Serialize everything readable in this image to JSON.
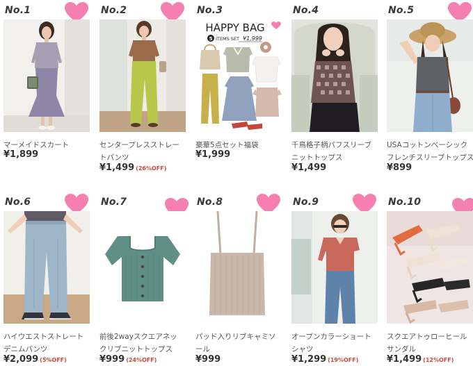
{
  "colors": {
    "heart": "#f57fb1",
    "rank_text": "#3a3a3a",
    "title_text": "#555555",
    "price_text": "#333333",
    "discount_text": "#d0473a"
  },
  "items": [
    {
      "rank": "No.1",
      "title_line1": "マーメイドスカート",
      "title_line2": "",
      "price": "¥1,899",
      "discount": "",
      "image": "model-lavender-mermaid-skirt"
    },
    {
      "rank": "No.2",
      "title_line1": "センタープレスストレー",
      "title_line2": "トパンツ",
      "price": "¥1,499",
      "discount": "(26%OFF)",
      "image": "model-lime-center-press-pants"
    },
    {
      "rank": "No.3",
      "title_line1": "豪華5点セット福袋",
      "title_line2": "",
      "price": "¥1,999",
      "discount": "",
      "image": "happy-bag-5-items-set",
      "banner": {
        "headline": "HAPPY BAG",
        "count": "5",
        "subline": "ITEMS SET",
        "price": "¥1,999"
      }
    },
    {
      "rank": "No.4",
      "title_line1": "千鳥格子柄パフスリーブ",
      "title_line2": "ニットトップス",
      "price": "¥1,499",
      "discount": "",
      "image": "model-houndstooth-puff-sleeve-knit"
    },
    {
      "rank": "No.5",
      "title_line1": "USAコットンベーシック",
      "title_line2": "フレンチスリーブトップス",
      "price": "¥899",
      "discount": "",
      "image": "model-gray-tee-straw-hat"
    },
    {
      "rank": "No.6",
      "title_line1": "ハイウエストストレート",
      "title_line2": "デニムパンツ",
      "price": "¥2,099",
      "discount": "(5%OFF)",
      "image": "model-light-straight-denim"
    },
    {
      "rank": "No.7",
      "title_line1": "前後2wayスクエアネッ",
      "title_line2": "クリブニットトップス",
      "price": "¥999",
      "discount": "(24%OFF)",
      "image": "green-square-neck-rib-knit"
    },
    {
      "rank": "No.8",
      "title_line1": "パッド入りリブキャミソ",
      "title_line2": "ール",
      "price": "¥999",
      "discount": "",
      "image": "beige-padded-rib-camisole"
    },
    {
      "rank": "No.9",
      "title_line1": "オープンカラーショート",
      "title_line2": "シャツ",
      "price": "¥1,299",
      "discount": "(19%OFF)",
      "image": "model-terracotta-open-collar-shirt"
    },
    {
      "rank": "No.10",
      "title_line1": "スクエアトゥローヒール",
      "title_line2": "サンダル",
      "price": "¥1,499",
      "discount": "(12%OFF)",
      "image": "square-toe-low-heel-sandals"
    }
  ]
}
